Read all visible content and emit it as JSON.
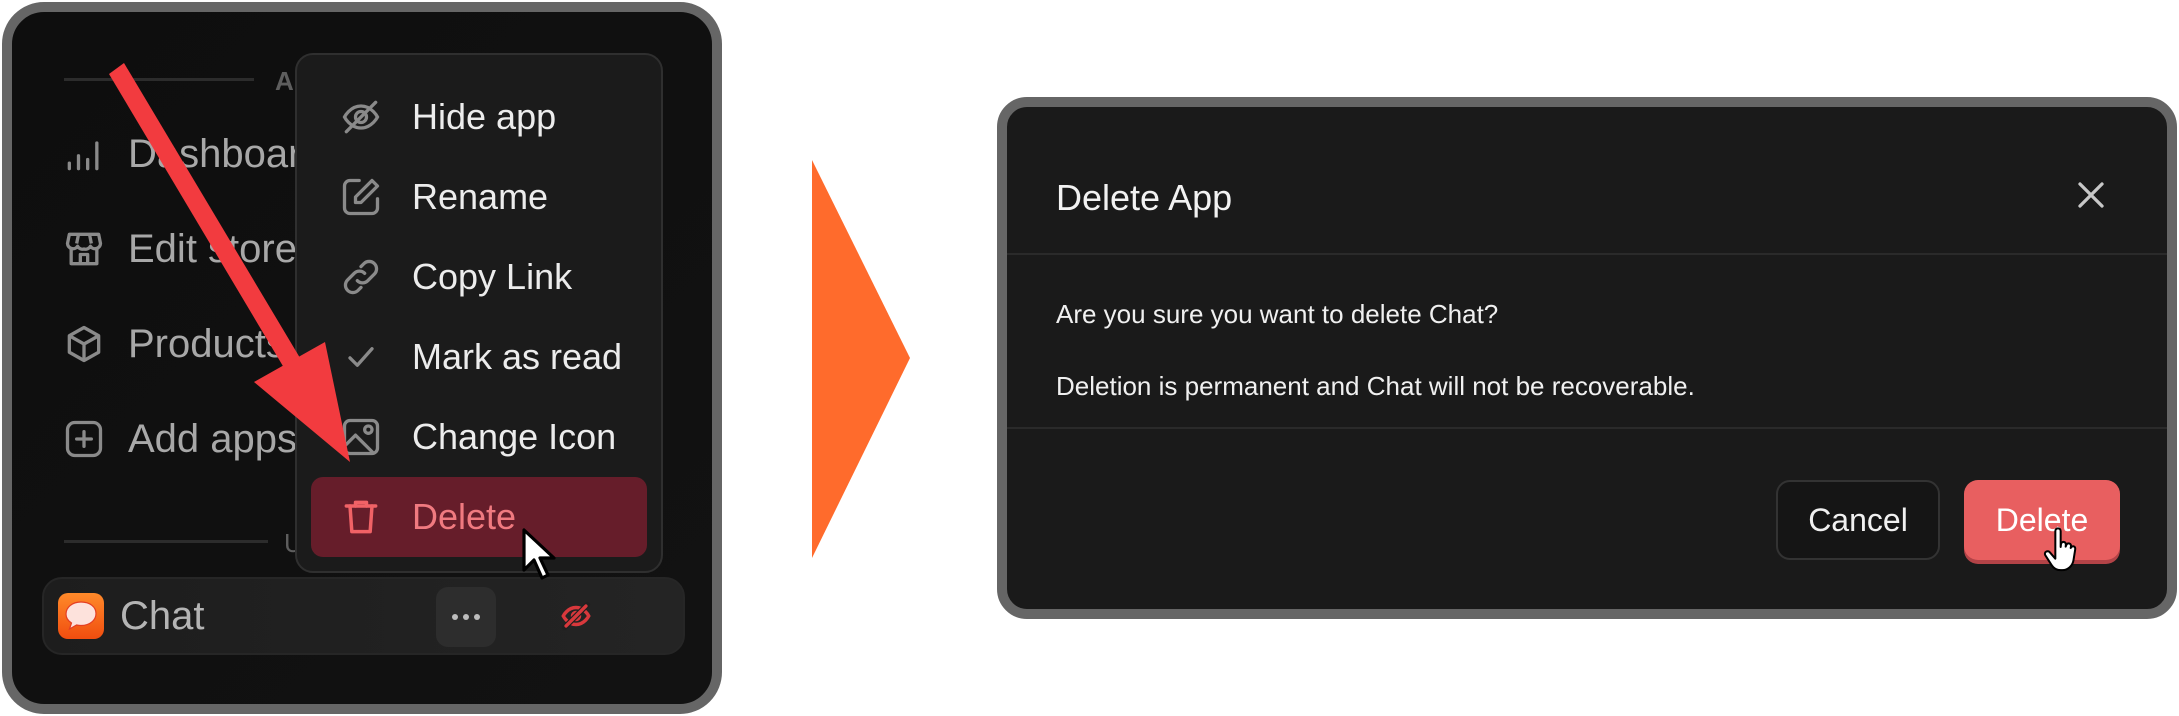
{
  "left_panel": {
    "section_label_top": "A",
    "nav_items": [
      {
        "label": "Dashboard",
        "icon": "bar-chart-icon"
      },
      {
        "label": "Edit store",
        "icon": "store-icon"
      },
      {
        "label": "Products",
        "icon": "cube-icon"
      },
      {
        "label": "Add apps",
        "icon": "plus-square-icon"
      }
    ],
    "section_label_bottom": "U",
    "app_row": {
      "label": "Chat",
      "icon": "chat-bubble-app-icon",
      "hidden_indicator": "eye-off-icon",
      "more_button": "more-horizontal-icon"
    }
  },
  "context_menu": {
    "items": [
      {
        "label": "Hide app",
        "icon": "eye-off-icon"
      },
      {
        "label": "Rename",
        "icon": "edit-icon"
      },
      {
        "label": "Copy Link",
        "icon": "link-icon"
      },
      {
        "label": "Mark as read",
        "icon": "check-icon"
      },
      {
        "label": "Change Icon",
        "icon": "image-icon"
      },
      {
        "label": "Delete",
        "icon": "trash-icon",
        "highlighted": true
      }
    ]
  },
  "transition_arrow": {
    "color": "#ff6b2c"
  },
  "annotation_arrow": {
    "color": "#f23b3f"
  },
  "dialog": {
    "title": "Delete App",
    "close_icon": "close-icon",
    "message": "Are you sure you want to delete Chat?",
    "warning": "Deletion is permanent and Chat will not be recoverable.",
    "cancel_label": "Cancel",
    "confirm_label": "Delete"
  },
  "colors": {
    "danger": "#e85f60",
    "danger_bg": "#661d2a",
    "danger_text": "#f07a80",
    "panel_border": "#666666"
  }
}
